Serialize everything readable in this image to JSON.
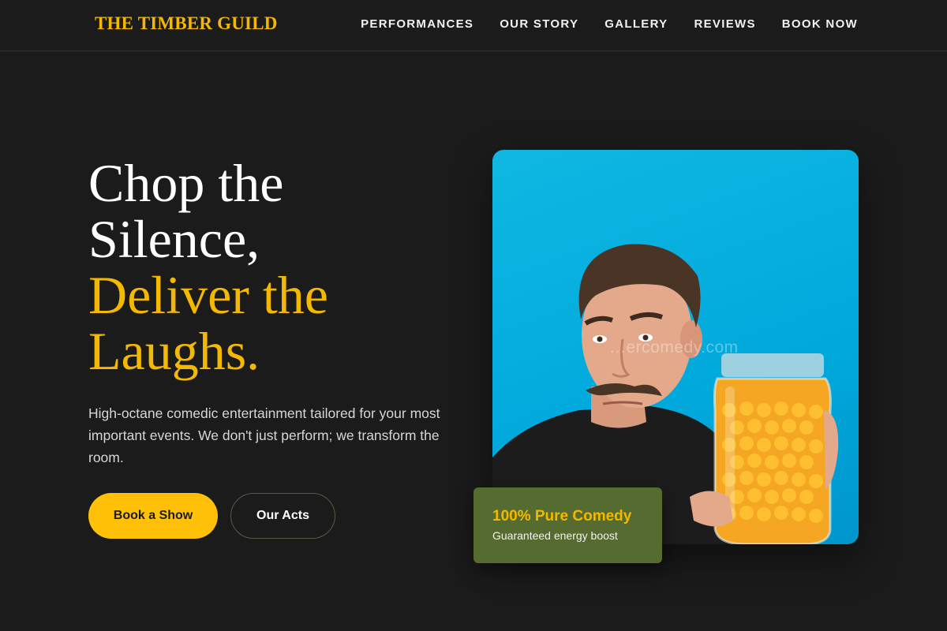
{
  "header": {
    "brand": "THE TIMBER GUILD",
    "nav": [
      "PERFORMANCES",
      "OUR STORY",
      "GALLERY",
      "REVIEWS",
      "BOOK NOW"
    ]
  },
  "hero": {
    "headline_white": [
      "Chop the",
      "Silence,"
    ],
    "headline_accent": [
      "Deliver the",
      "Laughs."
    ],
    "subtext": "High-octane comedic entertainment tailored for your most important events. We don't just perform; we transform the room.",
    "primary_button": "Book a Show",
    "secondary_button": "Our Acts",
    "image_watermark": "…ercomedy.com"
  },
  "badge": {
    "title": "100% Pure Comedy",
    "subtitle": "Guaranteed energy boost"
  },
  "colors": {
    "background": "#1b1b1b",
    "accent": "#f5b800",
    "button": "#ffc107",
    "badge": "#556b2f",
    "photo_bg": "#00b4e0"
  }
}
